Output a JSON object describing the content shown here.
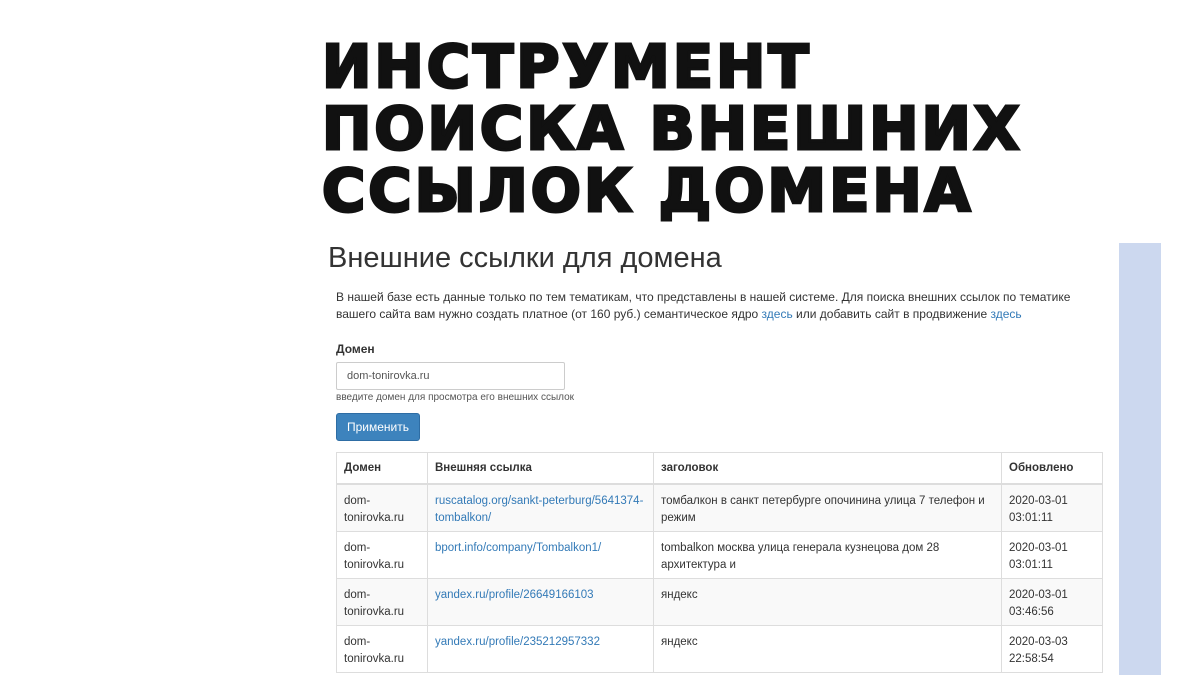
{
  "headline": [
    "ИНСТРУМЕНТ",
    "ПОИСКА ВНЕШНИХ",
    "ССЫЛОК ДОМЕНА"
  ],
  "page": {
    "title": "Внешние ссылки для домена",
    "intro_text_1": "В нашей базе есть данные только по тем тематикам, что представлены в нашей системе. Для поиска внешних ссылок по тематике вашего сайта вам нужно создать платное (от 160 руб.) семантическое ядро ",
    "intro_link_1": "здесь",
    "intro_text_2": " или добавить сайт в продвижение ",
    "intro_link_2": "здесь"
  },
  "form": {
    "domain_label": "Домен",
    "domain_value": "dom-tonirovka.ru",
    "domain_help": "введите домен для просмотра его внешних ссылок",
    "apply_label": "Применить"
  },
  "table": {
    "headers": [
      "Домен",
      "Внешняя ссылка",
      "заголовок",
      "Обновлено"
    ],
    "rows": [
      {
        "domain": "dom-tonirovka.ru",
        "link": "ruscatalog.org/sankt-peterburg/5641374-tombalkon/",
        "title": "томбалкон в санкт петербурге опочинина улица 7 телефон и режим",
        "updated": "2020-03-01 03:01:11"
      },
      {
        "domain": "dom-tonirovka.ru",
        "link": "bport.info/company/Tombalkon1/",
        "title": "tombalkon москва улица генерала кузнецова дом 28 архитектура и",
        "updated": "2020-03-01 03:01:11"
      },
      {
        "domain": "dom-tonirovka.ru",
        "link": "yandex.ru/profile/26649166103",
        "title": "яндекс",
        "updated": "2020-03-01 03:46:56"
      },
      {
        "domain": "dom-tonirovka.ru",
        "link": "yandex.ru/profile/235212957332",
        "title": "яндекс",
        "updated": "2020-03-03 22:58:54"
      }
    ]
  },
  "colors": {
    "accent": "#3d83bd",
    "link": "#337ab7",
    "side_bar": "#ccd8ef"
  }
}
